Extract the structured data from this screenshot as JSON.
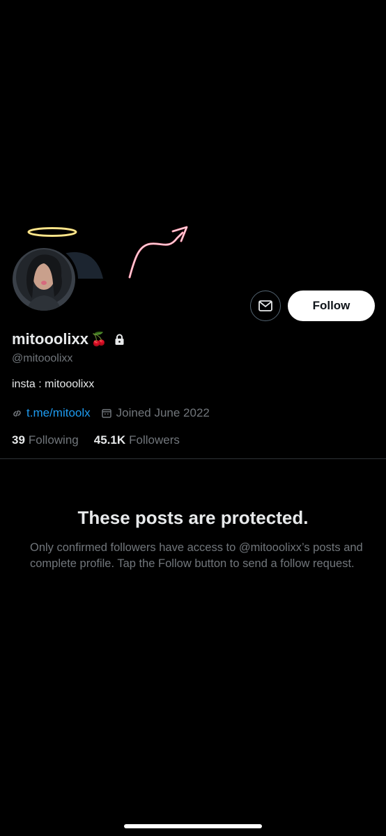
{
  "profile": {
    "display_name": "mitooolixx",
    "name_emoji": "🍒",
    "handle": "@mitooolixx",
    "bio": "insta : mitooolixx",
    "link": "t.me/mitoolx",
    "joined": "Joined June 2022",
    "following_count": "39",
    "following_label": "Following",
    "followers_count": "45.1K",
    "followers_label": "Followers"
  },
  "actions": {
    "follow_label": "Follow",
    "message_icon": "envelope-icon"
  },
  "protected": {
    "title": "These posts are protected.",
    "text": "Only confirmed followers have access to @mitooolixx’s posts and complete profile. Tap the Follow button to send a follow request."
  },
  "colors": {
    "background": "#000000",
    "link": "#1d9bf0",
    "secondary_text": "#71767b",
    "primary_text": "#e7e9ea",
    "follow_button": "#ffffff"
  }
}
